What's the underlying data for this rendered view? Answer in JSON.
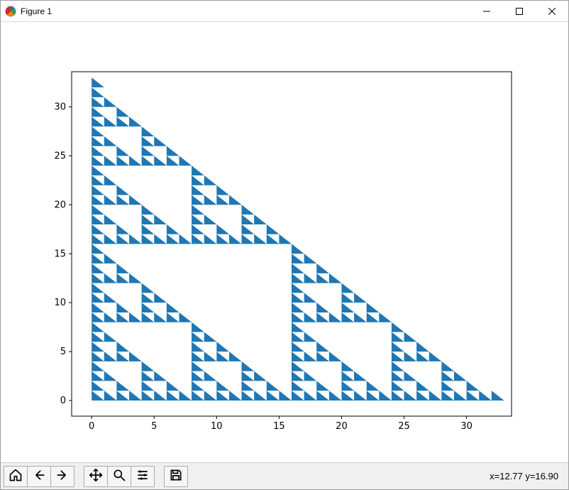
{
  "window": {
    "title": "Figure 1"
  },
  "toolbar": {
    "coord_readout": "x=12.77 y=16.90"
  },
  "chart_data": {
    "type": "scatter",
    "description": "Sierpinski triangle: lattice points (x, y) where C(x+y, x) is odd, for x+y < 32, plotted as filled blue right-triangle markers on an integer grid.",
    "fill_color": "#1f77b4",
    "xlabel": "",
    "ylabel": "",
    "title": "",
    "xlim": [
      -1.6,
      33.6
    ],
    "ylim": [
      -1.6,
      33.6
    ],
    "x_ticks": [
      0,
      5,
      10,
      15,
      20,
      25,
      30
    ],
    "y_ticks": [
      0,
      5,
      10,
      15,
      20,
      25,
      30
    ],
    "n": 32,
    "rule": "point (x,y) present iff (x & y) == 0, for x>=0, y>=0, x+y<=32"
  }
}
